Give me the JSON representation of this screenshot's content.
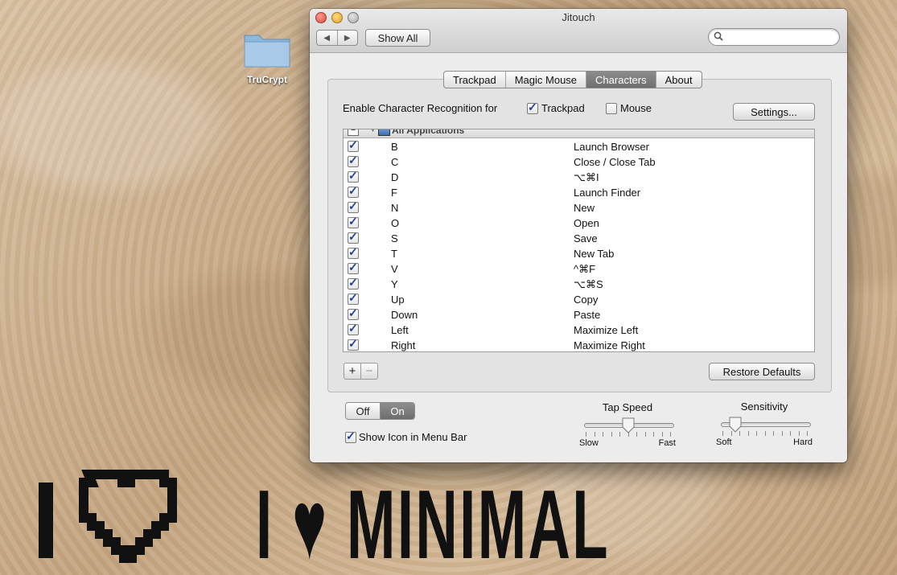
{
  "desktop": {
    "folder_label": "TruCrypt"
  },
  "wallpaper": {
    "logo_text": "I ♥ MINIMAL"
  },
  "window": {
    "title": "Jitouch",
    "toolbar": {
      "show_all_label": "Show All",
      "search_placeholder": ""
    },
    "tabs": [
      {
        "label": "Trackpad",
        "active": false
      },
      {
        "label": "Magic Mouse",
        "active": false
      },
      {
        "label": "Characters",
        "active": true
      },
      {
        "label": "About",
        "active": false
      }
    ],
    "recognition": {
      "label": "Enable Character Recognition for",
      "trackpad": {
        "label": "Trackpad",
        "checked": true
      },
      "mouse": {
        "label": "Mouse",
        "checked": false
      },
      "settings_label": "Settings..."
    },
    "list": {
      "group_label": "All Applications",
      "rows": [
        {
          "key": "B",
          "action": "Launch Browser",
          "checked": true
        },
        {
          "key": "C",
          "action": "Close / Close Tab",
          "checked": true
        },
        {
          "key": "D",
          "action": "⌥⌘I",
          "checked": true
        },
        {
          "key": "F",
          "action": "Launch Finder",
          "checked": true
        },
        {
          "key": "N",
          "action": "New",
          "checked": true
        },
        {
          "key": "O",
          "action": "Open",
          "checked": true
        },
        {
          "key": "S",
          "action": "Save",
          "checked": true
        },
        {
          "key": "T",
          "action": "New Tab",
          "checked": true
        },
        {
          "key": "V",
          "action": "^⌘F",
          "checked": true
        },
        {
          "key": "Y",
          "action": "⌥⌘S",
          "checked": true
        },
        {
          "key": "Up",
          "action": "Copy",
          "checked": true
        },
        {
          "key": "Down",
          "action": "Paste",
          "checked": true
        },
        {
          "key": "Left",
          "action": "Maximize Left",
          "checked": true
        },
        {
          "key": "Right",
          "action": "Maximize Right",
          "checked": true
        }
      ]
    },
    "list_controls": {
      "add_label": "+",
      "remove_label": "−",
      "restore_label": "Restore Defaults"
    },
    "power": {
      "off_label": "Off",
      "on_label": "On",
      "selected": "On"
    },
    "menu_bar": {
      "label": "Show Icon in Menu Bar",
      "checked": true
    },
    "tap_speed": {
      "title": "Tap Speed",
      "min_label": "Slow",
      "max_label": "Fast",
      "value": 0.5
    },
    "sensitivity": {
      "title": "Sensitivity",
      "min_label": "Soft",
      "max_label": "Hard",
      "value": 0.15
    }
  },
  "colors": {
    "selected_tab": "#7a7a7a",
    "checkmark": "#1f3f99"
  },
  "icons": [
    "folder-icon",
    "back-arrow-icon",
    "forward-arrow-icon",
    "search-icon",
    "app-window-icon",
    "disclosure-triangle-icon"
  ]
}
